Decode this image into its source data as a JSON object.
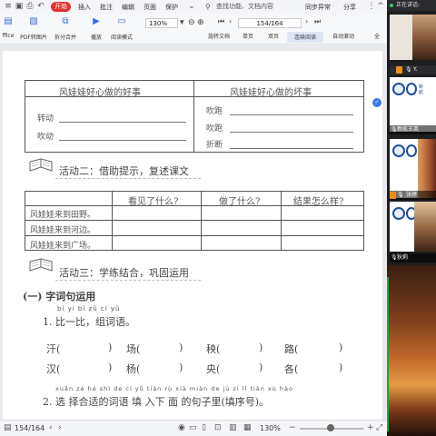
{
  "titlebar": {
    "open_label": "开始",
    "menus": [
      "插入",
      "批注",
      "编辑",
      "页面",
      "保护"
    ],
    "search_placeholder": "查找功能、文档内容",
    "sync_label": "同步异常",
    "share_label": "分享"
  },
  "toolbar": {
    "tools": [
      {
        "label": "ffice",
        "icon": "office-icon"
      },
      {
        "label": "PDF转图片",
        "icon": "pdf-image-icon"
      },
      {
        "label": "拆分合并",
        "icon": "split-merge-icon"
      },
      {
        "label": "播放",
        "icon": "play-icon"
      },
      {
        "label": "阅读模式",
        "icon": "read-mode-icon"
      },
      {
        "label": "旋转文档",
        "icon": "rotate-icon"
      },
      {
        "label": "单页",
        "icon": "single-page-icon"
      },
      {
        "label": "双页",
        "icon": "double-page-icon"
      },
      {
        "label": "连续阅读",
        "icon": "continuous-icon"
      },
      {
        "label": "自动滚动",
        "icon": "auto-scroll-icon"
      },
      {
        "label": "全",
        "icon": "full-icon"
      }
    ],
    "zoom_value": "130%",
    "page_indicator": "154/164"
  },
  "document": {
    "table1": {
      "headers": [
        "风娃娃好心做的好事",
        "风娃娃好心做的坏事"
      ],
      "left_items": [
        "转动",
        "吹动"
      ],
      "right_items": [
        "吹跑",
        "吹跑",
        "折断"
      ]
    },
    "activity2": {
      "title": "活动二：借助提示，复述课文",
      "headers": [
        "看见了什么?",
        "做了什么?",
        "结果怎么样?"
      ],
      "rows": [
        "风娃娃来到田野。",
        "风娃娃来到河边。",
        "风娃娃来到广场。"
      ]
    },
    "activity3": {
      "title": "活动三：学练结合，巩固运用",
      "subtitle": "(一) 字词句运用",
      "q1_pinyin": "bǐ yi bǐ  zǔ cí yǔ",
      "q1_text": "1. 比一比，组词语。",
      "row1": [
        "汗(",
        "场(",
        "秧(",
        "路("
      ],
      "row2": [
        "汉(",
        "杨(",
        "央(",
        "各("
      ],
      "q2_pinyin": "xuǎn zé hé shì de cí yǔ tián rù xià miàn de jù zi lǐ  tián xù hào",
      "q2_text": "2. 选 择合适的词语 填 入下 面 的句子里(填序号)。"
    }
  },
  "statusbar": {
    "page": "154/164",
    "zoom": "130%"
  },
  "side_panel": {
    "header": "正在讲话:",
    "participants": [
      {
        "name": "Y."
      },
      {
        "name": "新航王英"
      },
      {
        "name": "张婷"
      },
      {
        "name": "狄莉"
      }
    ],
    "tile_text": [
      "新",
      "航",
      "小",
      "学"
    ]
  }
}
